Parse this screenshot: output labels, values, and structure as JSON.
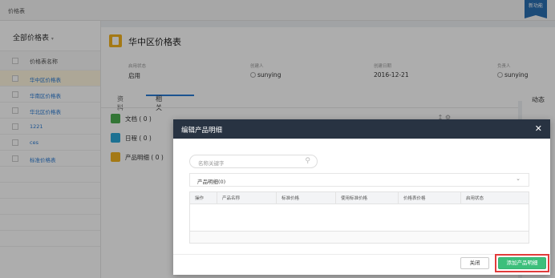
{
  "topbar": {
    "breadcrumb": "价格表",
    "flag_label": "新功能"
  },
  "sidebar": {
    "title": "全部价格表",
    "header_label": "价格表名称",
    "items": [
      "华中区价格表",
      "华南区价格表",
      "华北区价格表",
      "1221",
      "ces",
      "标准价格表"
    ]
  },
  "record": {
    "name": "华中区价格表",
    "fields": [
      {
        "label": "启用状态",
        "value": "启用"
      },
      {
        "label": "创建人",
        "value": "sunying"
      },
      {
        "label": "创建日期",
        "value": "2016-12-21"
      },
      {
        "label": "负责人",
        "value": "sunying"
      }
    ]
  },
  "tabs": {
    "tab1": "资料",
    "tab2": "相关",
    "right_label": "动态"
  },
  "related": [
    {
      "label": "文档 ( 0 )",
      "color": "#4caf50"
    },
    {
      "label": "日程 ( 0 )",
      "color": "#2aa7d8"
    },
    {
      "label": "产品明细 ( 0 )",
      "color": "#f2b31f"
    }
  ],
  "modal": {
    "title": "编辑产品明细",
    "search_placeholder": "名称关键字",
    "section_label": "产品明细(0)",
    "columns": [
      "操作",
      "产品名称",
      "标准价格",
      "使用标准价格",
      "价格表价格",
      "启用状态"
    ],
    "close_label": "关闭",
    "add_label": "添加产品明细"
  }
}
